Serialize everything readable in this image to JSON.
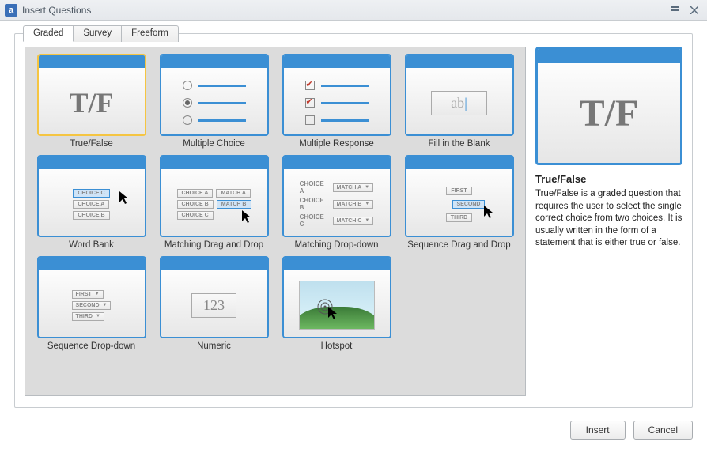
{
  "window": {
    "title": "Insert Questions",
    "app_icon_letter": "a"
  },
  "tabs": [
    {
      "label": "Graded",
      "active": true
    },
    {
      "label": "Survey",
      "active": false
    },
    {
      "label": "Freeform",
      "active": false
    }
  ],
  "questions": [
    {
      "id": "true-false",
      "label": "True/False",
      "selected": true
    },
    {
      "id": "multiple-choice",
      "label": "Multiple Choice",
      "selected": false
    },
    {
      "id": "multiple-response",
      "label": "Multiple Response",
      "selected": false
    },
    {
      "id": "fill-in-the-blank",
      "label": "Fill in the Blank",
      "selected": false
    },
    {
      "id": "word-bank",
      "label": "Word Bank",
      "selected": false
    },
    {
      "id": "matching-drag-and-drop",
      "label": "Matching Drag and Drop",
      "selected": false
    },
    {
      "id": "matching-drop-down",
      "label": "Matching Drop-down",
      "selected": false
    },
    {
      "id": "sequence-drag-and-drop",
      "label": "Sequence Drag and Drop",
      "selected": false
    },
    {
      "id": "sequence-drop-down",
      "label": "Sequence Drop-down",
      "selected": false
    },
    {
      "id": "numeric",
      "label": "Numeric",
      "selected": false
    },
    {
      "id": "hotspot",
      "label": "Hotspot",
      "selected": false
    }
  ],
  "thumb_text": {
    "tf": "T/F",
    "blank": "ab",
    "choice_a": "CHOICE A",
    "choice_b": "CHOICE B",
    "choice_c": "CHOICE C",
    "match_a": "MATCH A",
    "match_b": "MATCH B",
    "match_c": "MATCH C",
    "first": "FIRST",
    "second": "SECOND",
    "third": "THIRD",
    "num": "123"
  },
  "detail": {
    "title": "True/False",
    "description": "True/False is a graded question that requires the user to select the single correct choice from two choices.  It is usually written in the form of a statement that is either true or false."
  },
  "buttons": {
    "insert": "Insert",
    "cancel": "Cancel"
  }
}
